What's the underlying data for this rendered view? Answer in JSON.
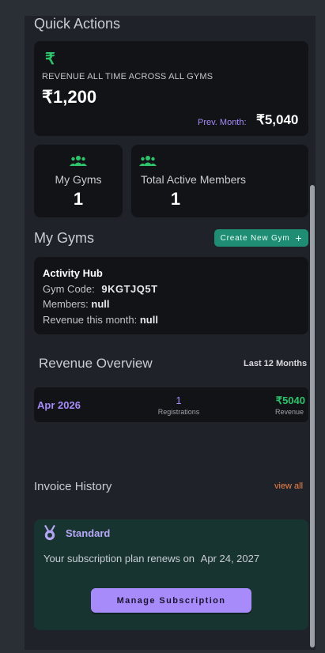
{
  "quick_actions": {
    "title": "Quick Actions",
    "revenue_label": "REVENUE ALL TIME ACROSS ALL GYMS",
    "revenue_value": "₹1,200",
    "prev_month_label": "Prev. Month:",
    "prev_month_value": "₹5,040",
    "rupee_icon": "₹",
    "stats": [
      {
        "label": "My Gyms",
        "value": "1",
        "icon": "group-icon"
      },
      {
        "label": "Total Active Members",
        "value": "1",
        "icon": "group-icon"
      }
    ]
  },
  "my_gyms": {
    "title": "My Gyms",
    "create_label": "Create New Gym",
    "gym": {
      "name": "Activity Hub",
      "code_label": "Gym Code:",
      "code_value": "9KGTJQ5T",
      "members_label": "Members:",
      "members_value": "null",
      "revenue_label": "Revenue this month:",
      "revenue_value": "null"
    }
  },
  "revenue_overview": {
    "title": "Revenue Overview",
    "period": "Last 12 Months",
    "rows": [
      {
        "month": "Apr 2026",
        "registrations": "1",
        "registrations_label": "Registrations",
        "revenue": "₹5040",
        "revenue_label": "Revenue"
      }
    ]
  },
  "invoice_history": {
    "title": "Invoice History",
    "view_all": "view all"
  },
  "subscription": {
    "plan": "Standard",
    "renew_text": "Your subscription plan renews on",
    "renew_date": "Apr 24, 2027",
    "manage_label": "Manage Subscription"
  },
  "colors": {
    "accent_green": "#2ec26a",
    "accent_purple": "#a78bfa",
    "accent_orange": "#f0834a",
    "teal_button": "#1f8c74"
  }
}
